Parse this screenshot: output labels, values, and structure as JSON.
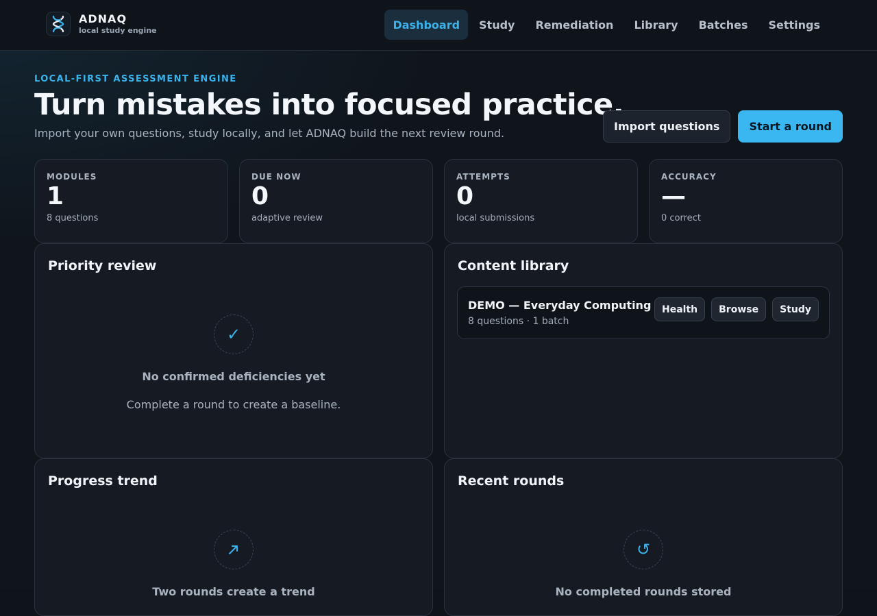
{
  "brand": {
    "name": "ADNAQ",
    "subtitle": "local study engine"
  },
  "nav": {
    "items": [
      {
        "label": "Dashboard",
        "active": true
      },
      {
        "label": "Study"
      },
      {
        "label": "Remediation"
      },
      {
        "label": "Library"
      },
      {
        "label": "Batches"
      },
      {
        "label": "Settings"
      }
    ]
  },
  "hero": {
    "eyebrow": "LOCAL-FIRST ASSESSMENT ENGINE",
    "title": "Turn mistakes into focused practice.",
    "subtitle": "Import your own questions, study locally, and let ADNAQ build the next review round.",
    "import_label": "Import questions",
    "start_label": "Start a round"
  },
  "stats": [
    {
      "label": "MODULES",
      "value": "1",
      "note": "8 questions"
    },
    {
      "label": "DUE NOW",
      "value": "0",
      "note": "adaptive review"
    },
    {
      "label": "ATTEMPTS",
      "value": "0",
      "note": "local submissions"
    },
    {
      "label": "ACCURACY",
      "value": "—",
      "note": "0 correct"
    }
  ],
  "priority": {
    "title": "Priority review",
    "icon": "check-icon",
    "empty_title": "No confirmed deficiencies yet",
    "empty_desc": "Complete a round to create a baseline."
  },
  "library": {
    "title": "Content library",
    "items": [
      {
        "name": "DEMO — Everyday Computing",
        "meta": "8 questions · 1 batch",
        "actions": [
          "Health",
          "Browse",
          "Study"
        ]
      }
    ]
  },
  "trend": {
    "title": "Progress trend",
    "icon": "trend-arrow-icon",
    "empty_title": "Two rounds create a trend"
  },
  "rounds": {
    "title": "Recent rounds",
    "icon": "refresh-icon",
    "empty_title": "No completed rounds stored"
  },
  "colors": {
    "accent": "#3bb2ea",
    "background": "#10151c",
    "panel": "#161b23"
  }
}
